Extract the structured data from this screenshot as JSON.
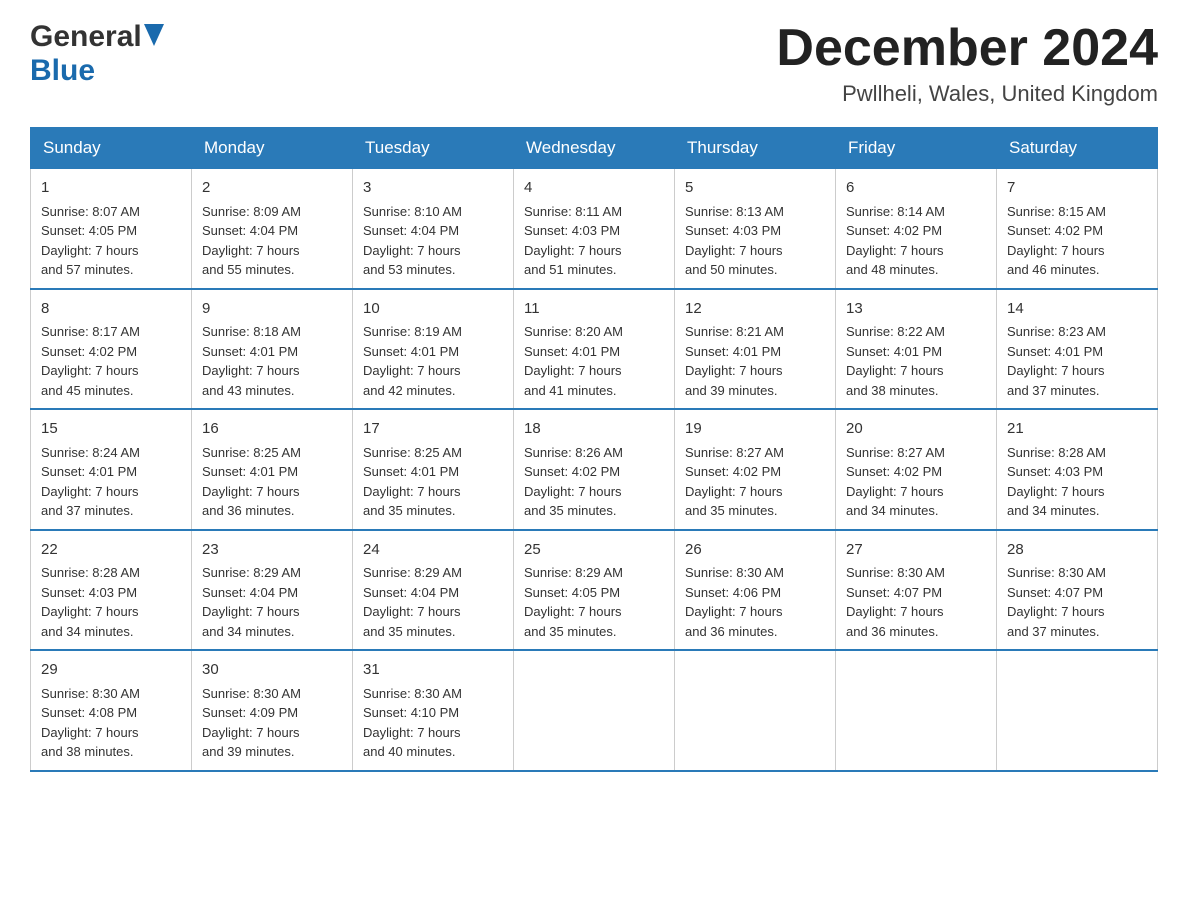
{
  "header": {
    "logo_general": "General",
    "logo_blue": "Blue",
    "title": "December 2024",
    "subtitle": "Pwllheli, Wales, United Kingdom"
  },
  "calendar": {
    "days_of_week": [
      "Sunday",
      "Monday",
      "Tuesday",
      "Wednesday",
      "Thursday",
      "Friday",
      "Saturday"
    ],
    "weeks": [
      [
        {
          "day": "1",
          "sunrise": "8:07 AM",
          "sunset": "4:05 PM",
          "daylight": "7 hours and 57 minutes."
        },
        {
          "day": "2",
          "sunrise": "8:09 AM",
          "sunset": "4:04 PM",
          "daylight": "7 hours and 55 minutes."
        },
        {
          "day": "3",
          "sunrise": "8:10 AM",
          "sunset": "4:04 PM",
          "daylight": "7 hours and 53 minutes."
        },
        {
          "day": "4",
          "sunrise": "8:11 AM",
          "sunset": "4:03 PM",
          "daylight": "7 hours and 51 minutes."
        },
        {
          "day": "5",
          "sunrise": "8:13 AM",
          "sunset": "4:03 PM",
          "daylight": "7 hours and 50 minutes."
        },
        {
          "day": "6",
          "sunrise": "8:14 AM",
          "sunset": "4:02 PM",
          "daylight": "7 hours and 48 minutes."
        },
        {
          "day": "7",
          "sunrise": "8:15 AM",
          "sunset": "4:02 PM",
          "daylight": "7 hours and 46 minutes."
        }
      ],
      [
        {
          "day": "8",
          "sunrise": "8:17 AM",
          "sunset": "4:02 PM",
          "daylight": "7 hours and 45 minutes."
        },
        {
          "day": "9",
          "sunrise": "8:18 AM",
          "sunset": "4:01 PM",
          "daylight": "7 hours and 43 minutes."
        },
        {
          "day": "10",
          "sunrise": "8:19 AM",
          "sunset": "4:01 PM",
          "daylight": "7 hours and 42 minutes."
        },
        {
          "day": "11",
          "sunrise": "8:20 AM",
          "sunset": "4:01 PM",
          "daylight": "7 hours and 41 minutes."
        },
        {
          "day": "12",
          "sunrise": "8:21 AM",
          "sunset": "4:01 PM",
          "daylight": "7 hours and 39 minutes."
        },
        {
          "day": "13",
          "sunrise": "8:22 AM",
          "sunset": "4:01 PM",
          "daylight": "7 hours and 38 minutes."
        },
        {
          "day": "14",
          "sunrise": "8:23 AM",
          "sunset": "4:01 PM",
          "daylight": "7 hours and 37 minutes."
        }
      ],
      [
        {
          "day": "15",
          "sunrise": "8:24 AM",
          "sunset": "4:01 PM",
          "daylight": "7 hours and 37 minutes."
        },
        {
          "day": "16",
          "sunrise": "8:25 AM",
          "sunset": "4:01 PM",
          "daylight": "7 hours and 36 minutes."
        },
        {
          "day": "17",
          "sunrise": "8:25 AM",
          "sunset": "4:01 PM",
          "daylight": "7 hours and 35 minutes."
        },
        {
          "day": "18",
          "sunrise": "8:26 AM",
          "sunset": "4:02 PM",
          "daylight": "7 hours and 35 minutes."
        },
        {
          "day": "19",
          "sunrise": "8:27 AM",
          "sunset": "4:02 PM",
          "daylight": "7 hours and 35 minutes."
        },
        {
          "day": "20",
          "sunrise": "8:27 AM",
          "sunset": "4:02 PM",
          "daylight": "7 hours and 34 minutes."
        },
        {
          "day": "21",
          "sunrise": "8:28 AM",
          "sunset": "4:03 PM",
          "daylight": "7 hours and 34 minutes."
        }
      ],
      [
        {
          "day": "22",
          "sunrise": "8:28 AM",
          "sunset": "4:03 PM",
          "daylight": "7 hours and 34 minutes."
        },
        {
          "day": "23",
          "sunrise": "8:29 AM",
          "sunset": "4:04 PM",
          "daylight": "7 hours and 34 minutes."
        },
        {
          "day": "24",
          "sunrise": "8:29 AM",
          "sunset": "4:04 PM",
          "daylight": "7 hours and 35 minutes."
        },
        {
          "day": "25",
          "sunrise": "8:29 AM",
          "sunset": "4:05 PM",
          "daylight": "7 hours and 35 minutes."
        },
        {
          "day": "26",
          "sunrise": "8:30 AM",
          "sunset": "4:06 PM",
          "daylight": "7 hours and 36 minutes."
        },
        {
          "day": "27",
          "sunrise": "8:30 AM",
          "sunset": "4:07 PM",
          "daylight": "7 hours and 36 minutes."
        },
        {
          "day": "28",
          "sunrise": "8:30 AM",
          "sunset": "4:07 PM",
          "daylight": "7 hours and 37 minutes."
        }
      ],
      [
        {
          "day": "29",
          "sunrise": "8:30 AM",
          "sunset": "4:08 PM",
          "daylight": "7 hours and 38 minutes."
        },
        {
          "day": "30",
          "sunrise": "8:30 AM",
          "sunset": "4:09 PM",
          "daylight": "7 hours and 39 minutes."
        },
        {
          "day": "31",
          "sunrise": "8:30 AM",
          "sunset": "4:10 PM",
          "daylight": "7 hours and 40 minutes."
        },
        null,
        null,
        null,
        null
      ]
    ],
    "labels": {
      "sunrise": "Sunrise:",
      "sunset": "Sunset:",
      "daylight": "Daylight:"
    }
  }
}
